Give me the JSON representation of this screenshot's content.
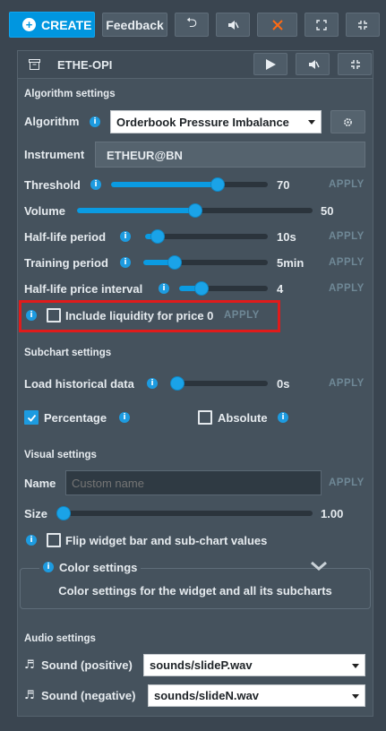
{
  "toolbar": {
    "create_label": "CREATE",
    "feedback_label": "Feedback"
  },
  "widget": {
    "title": "ETHE-OPI"
  },
  "algorithm_settings": {
    "heading": "Algorithm settings",
    "algorithm_label": "Algorithm",
    "algorithm_value": "Orderbook Pressure Imbalance",
    "instrument_label": "Instrument",
    "instrument_value": "ETHEUR@BN",
    "threshold": {
      "label": "Threshold",
      "value": "70",
      "level": 0.68,
      "apply": "APPLY"
    },
    "volume": {
      "label": "Volume",
      "value": "50",
      "level": 0.5
    },
    "half_life_period": {
      "label": "Half-life period",
      "value": "10s",
      "level": 0.1,
      "apply": "APPLY"
    },
    "training_period": {
      "label": "Training period",
      "value": "5min",
      "level": 0.25,
      "apply": "APPLY"
    },
    "half_life_price_interval": {
      "label": "Half-life price interval",
      "value": "4",
      "level": 0.25,
      "apply": "APPLY"
    },
    "include_liquidity": {
      "label": "Include liquidity for price 0",
      "checked": false,
      "apply": "APPLY"
    }
  },
  "subchart_settings": {
    "heading": "Subchart settings",
    "load_historical": {
      "label": "Load historical data",
      "value": "0s",
      "level": 0.0,
      "apply": "APPLY"
    },
    "percentage": {
      "label": "Percentage",
      "checked": true
    },
    "absolute": {
      "label": "Absolute",
      "checked": false
    }
  },
  "visual_settings": {
    "heading": "Visual settings",
    "name_label": "Name",
    "name_placeholder": "Custom name",
    "name_apply": "APPLY",
    "size_label": "Size",
    "size_value": "1.00",
    "size_level": 0.0,
    "flip_label": "Flip widget bar and sub-chart values",
    "flip_checked": false,
    "color_settings_title": "Color settings",
    "color_settings_desc": "Color settings for the widget and all its subcharts"
  },
  "audio_settings": {
    "heading": "Audio settings",
    "positive_label": "Sound (positive)",
    "positive_value": "sounds/slideP.wav",
    "negative_label": "Sound (negative)",
    "negative_value": "sounds/slideN.wav"
  },
  "colors": {
    "accent": "#0096e0",
    "highlight": "#e01b1b",
    "close": "#ff6a13"
  }
}
